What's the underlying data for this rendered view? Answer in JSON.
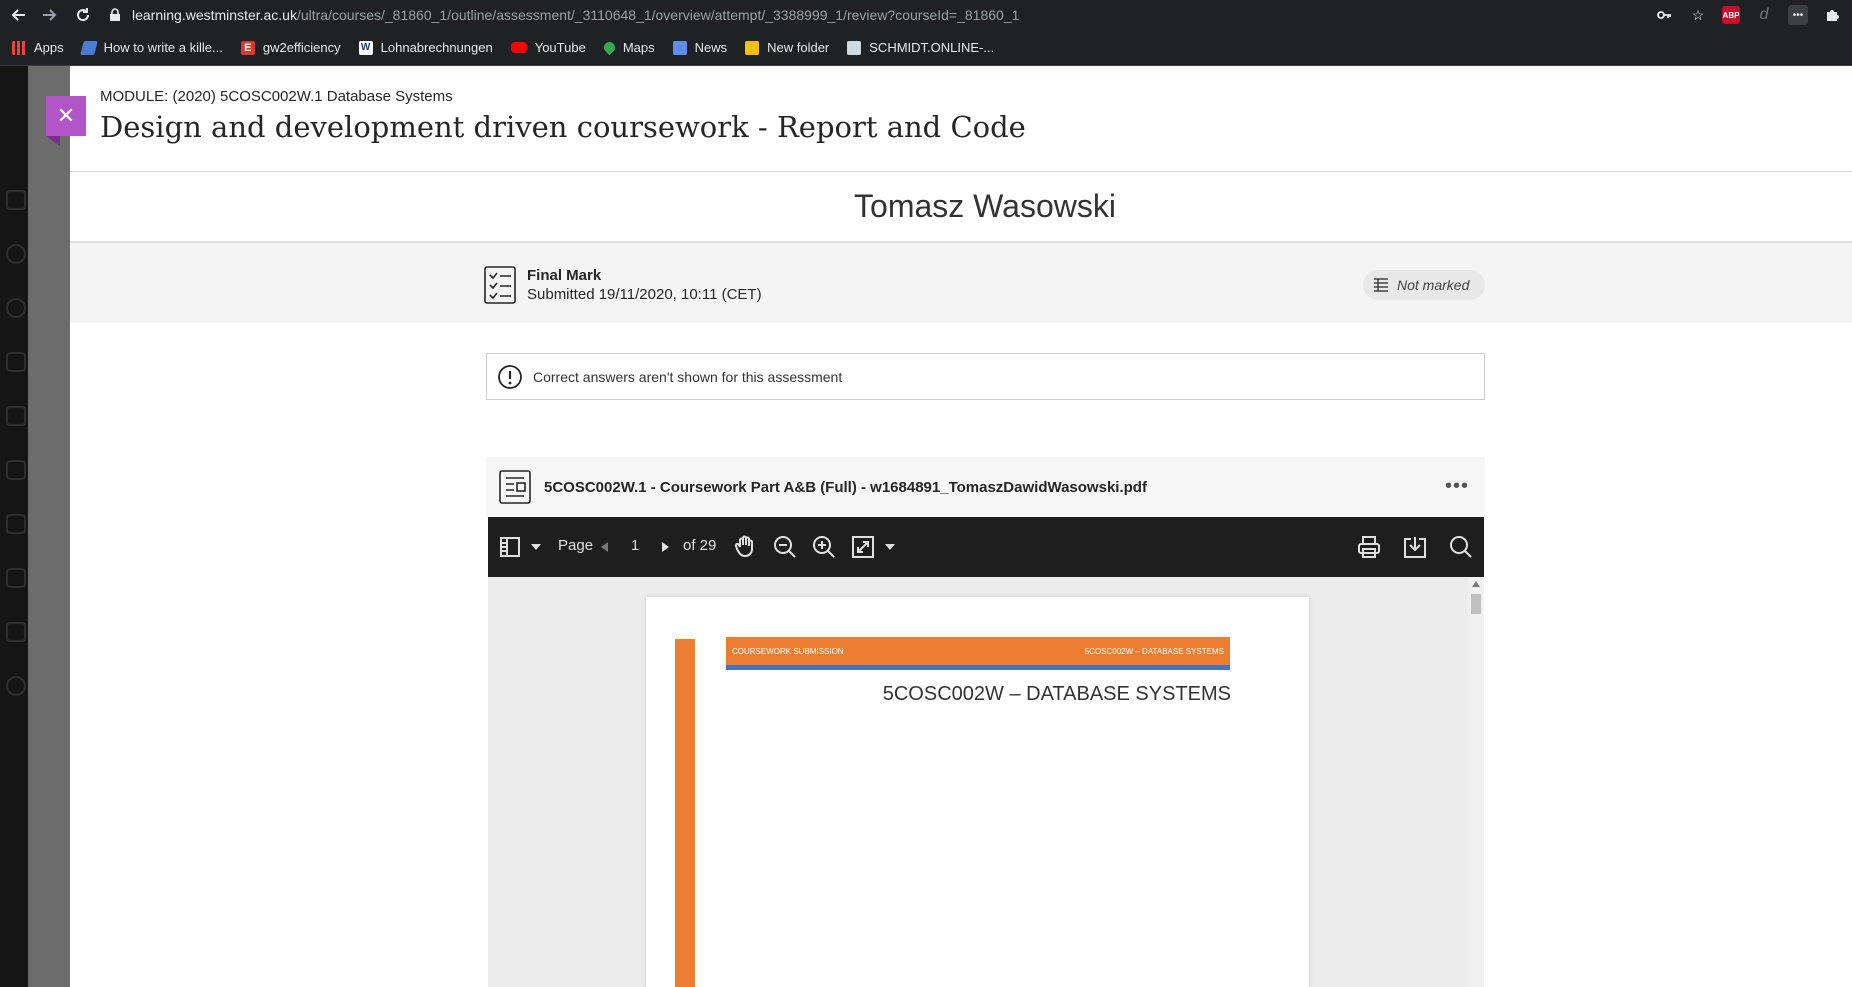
{
  "browser": {
    "url_host": "learning.westminster.ac.uk",
    "url_path": "/ultra/courses/_81860_1/outline/assessment/_3110648_1/overview/attempt/_3388999_1/review?courseId=_81860_1",
    "abp_label": "ABP",
    "bookmarks": [
      {
        "label": "Apps",
        "icon": "apps-grid-icon",
        "color": "#e8453c"
      },
      {
        "label": "How to write a kille...",
        "icon": "feather-icon",
        "color": "#4a7bd1"
      },
      {
        "label": "gw2efficiency",
        "icon": "e-logo-icon",
        "color": "#d93a2b"
      },
      {
        "label": "Lohnabrechnungen",
        "icon": "w-logo-icon",
        "color": "#ffffff"
      },
      {
        "label": "YouTube",
        "icon": "youtube-icon",
        "color": "#ff0000"
      },
      {
        "label": "Maps",
        "icon": "maps-pin-icon",
        "color": "#34a853"
      },
      {
        "label": "News",
        "icon": "news-icon",
        "color": "#5f8ff0"
      },
      {
        "label": "New folder",
        "icon": "folder-icon",
        "color": "#f4c20d"
      },
      {
        "label": "SCHMIDT.ONLINE-...",
        "icon": "schmidt-icon",
        "color": "#cfd8e3"
      }
    ]
  },
  "header": {
    "module": "MODULE: (2020) 5COSC002W.1 Database Systems",
    "title": "Design and development driven coursework - Report and Code"
  },
  "student_name": "Tomasz Wasowski",
  "mark": {
    "title": "Final Mark",
    "submitted": "Submitted 19/11/2020, 10:11 (CET)",
    "status": "Not marked"
  },
  "notice": "Correct answers aren't shown for this assessment",
  "file": {
    "name": "5COSC002W.1 - Coursework Part A&B (Full) - w1684891_TomaszDawidWasowski.pdf",
    "more": "•••"
  },
  "pdf": {
    "page_label": "Page",
    "current_page": "1",
    "total": "of 29"
  },
  "document": {
    "header_left": "COURSEWORK SUBMISSION",
    "header_right": "5COSC002W – DATABASE SYSTEMS",
    "title": "5COSC002W – DATABASE SYSTEMS",
    "accent": "#ed7d31",
    "secondary": "#4472c4"
  },
  "colors": {
    "close_button": "#b255c6"
  }
}
